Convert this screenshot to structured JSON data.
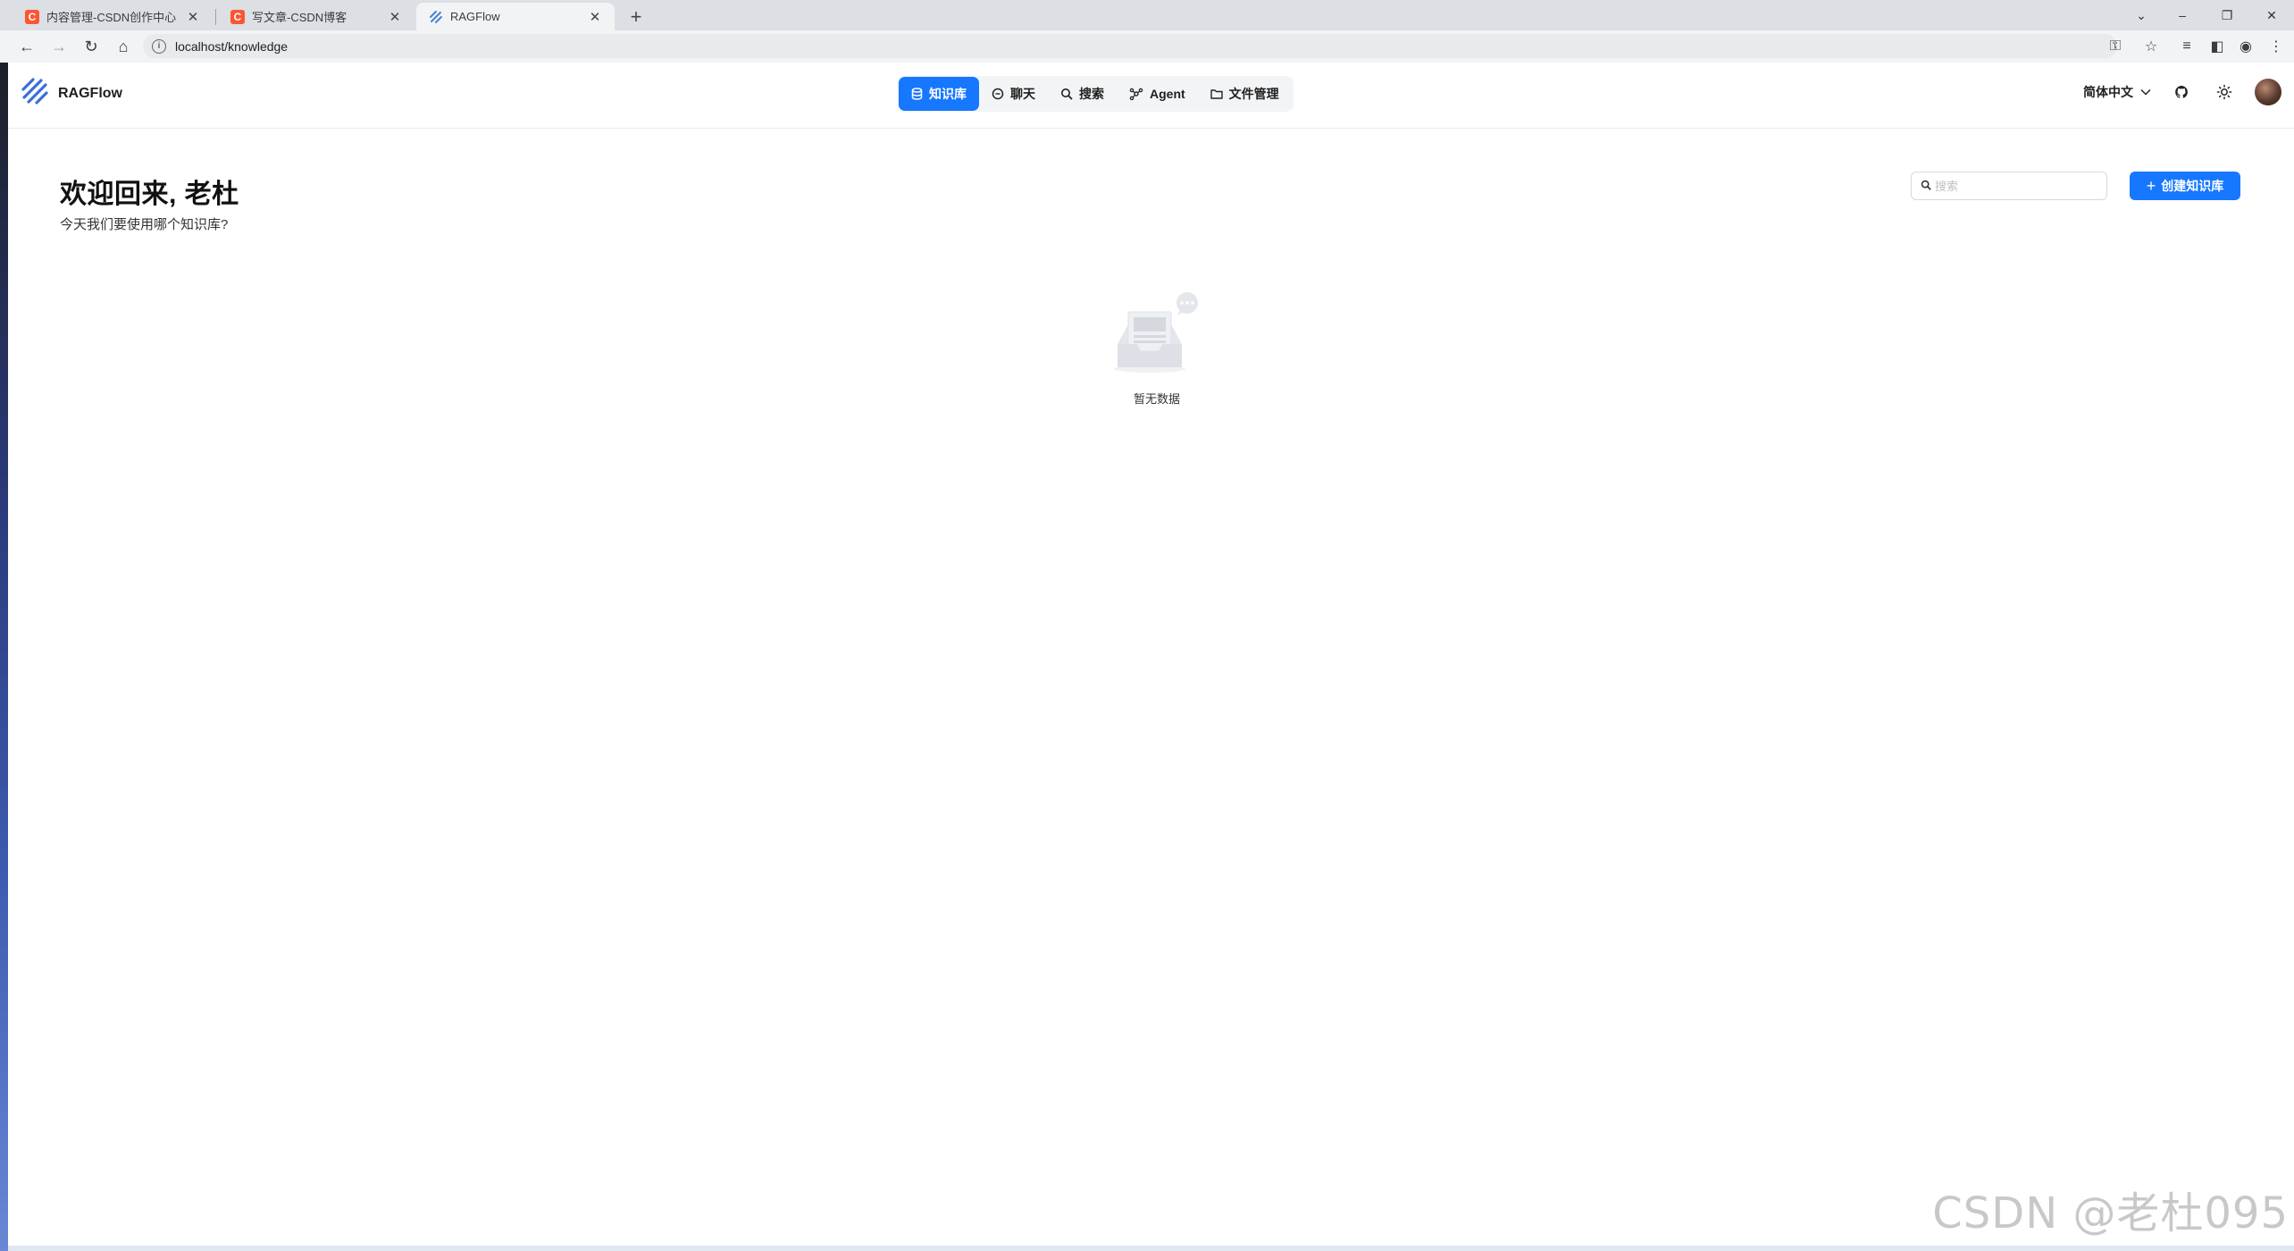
{
  "browser": {
    "tabs": [
      {
        "title": "内容管理-CSDN创作中心",
        "favicon": "csdn-icon",
        "active": false
      },
      {
        "title": "写文章-CSDN博客",
        "favicon": "csdn-icon",
        "active": false
      },
      {
        "title": "RAGFlow",
        "favicon": "ragflow-icon",
        "active": true
      }
    ],
    "favicon_letter": "C",
    "url": "localhost/knowledge"
  },
  "app": {
    "name": "RAGFlow",
    "nav": [
      {
        "label": "知识库",
        "icon": "database-icon",
        "active": true
      },
      {
        "label": "聊天",
        "icon": "chat-icon",
        "active": false
      },
      {
        "label": "搜索",
        "icon": "search-icon",
        "active": false
      },
      {
        "label": "Agent",
        "icon": "agent-icon",
        "active": false
      },
      {
        "label": "文件管理",
        "icon": "folder-icon",
        "active": false
      }
    ],
    "language": "简体中文",
    "accent_color": "#1677ff"
  },
  "main": {
    "welcome_title": "欢迎回来, 老杜",
    "welcome_subtitle": "今天我们要使用哪个知识库?",
    "search_placeholder": "搜索",
    "create_button": "创建知识库",
    "empty_text": "暂无数据"
  },
  "watermark": "CSDN @老杜095"
}
